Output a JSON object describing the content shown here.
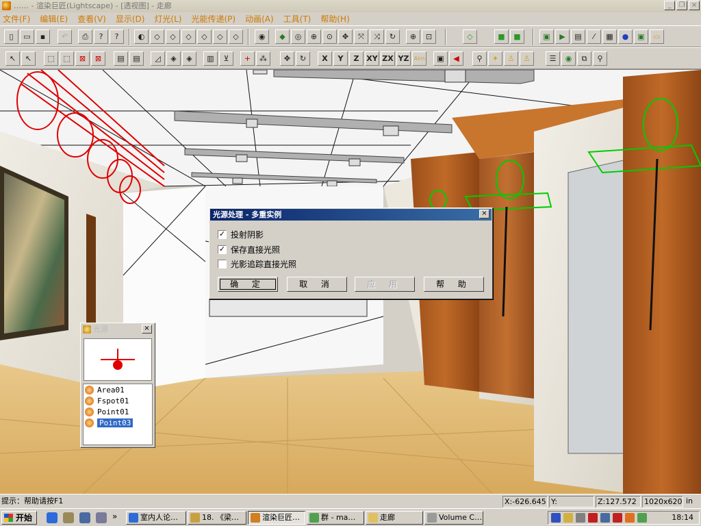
{
  "window": {
    "title": "…… - 渲染巨匠(Lightscape) - [透视图] - 走廊",
    "btn_min": "_",
    "btn_restore": "❐",
    "btn_close": "×"
  },
  "menu": [
    "文件(F)",
    "编辑(E)",
    "查看(V)",
    "显示(D)",
    "灯光(L)",
    "光能传递(P)",
    "动画(A)",
    "工具(T)",
    "帮助(H)"
  ],
  "toolbar2_text": [
    "X",
    "Y",
    "Z",
    "XY",
    "ZX",
    "YZ",
    "Aim"
  ],
  "dialog": {
    "title": "光源处理 - 多重实例",
    "close": "×",
    "options": [
      {
        "label": "投射阴影",
        "checked": true
      },
      {
        "label": "保存直接光照",
        "checked": true
      },
      {
        "label": "光影追踪直接光照",
        "checked": false
      }
    ],
    "buttons": {
      "ok": "确 定",
      "cancel": "取 消",
      "apply": "应 用",
      "help": "帮 助"
    }
  },
  "panel": {
    "title": "光源",
    "close": "×",
    "items": [
      {
        "name": "Area01",
        "selected": false
      },
      {
        "name": "Fspot01",
        "selected": false
      },
      {
        "name": "Point01",
        "selected": false
      },
      {
        "name": "Point03",
        "selected": true
      }
    ]
  },
  "status": {
    "hint": "提示：帮助请按F1",
    "x": "X:-626.645",
    "y": "Y:",
    "z": "Z:127.572",
    "size": "1020x620",
    "unit": "in"
  },
  "taskbar": {
    "start": "开始",
    "more": "»",
    "tasks": [
      {
        "label": "室内人论…",
        "active": false
      },
      {
        "label": "18. 《梁…",
        "active": false
      },
      {
        "label": "渲染巨匠…",
        "active": true
      },
      {
        "label": "群 - ma…",
        "active": false
      },
      {
        "label": "走廊",
        "active": false
      },
      {
        "label": "Volume C…",
        "active": false
      }
    ],
    "clock": "18:14"
  }
}
